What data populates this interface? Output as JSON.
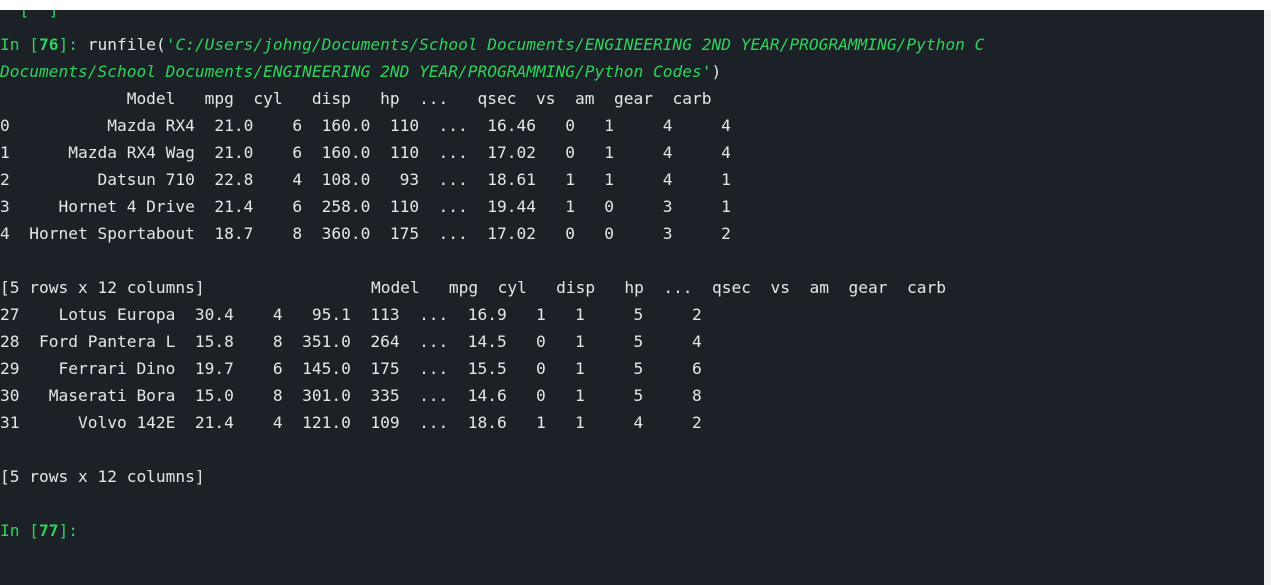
{
  "prev_prompt_fragment": "  [  ]",
  "input1": {
    "prompt_prefix": "In [",
    "prompt_number": "76",
    "prompt_suffix": "]: ",
    "call_name": "runfile(",
    "arg_line1": "'C:/Users/johng/Documents/School Documents/ENGINEERING 2ND YEAR/PROGRAMMING/Python C",
    "arg_line2": "Documents/School Documents/ENGINEERING 2ND YEAR/PROGRAMMING/Python Codes'",
    "close_paren": ")"
  },
  "head_table": {
    "header": "             Model   mpg  cyl   disp   hp  ...   qsec  vs  am  gear  carb",
    "rows": [
      "0          Mazda RX4  21.0    6  160.0  110  ...  16.46   0   1     4     4",
      "1      Mazda RX4 Wag  21.0    6  160.0  110  ...  17.02   0   1     4     4",
      "2         Datsun 710  22.8    4  108.0   93  ...  18.61   1   1     4     1",
      "3     Hornet 4 Drive  21.4    6  258.0  110  ...  19.44   1   0     3     1",
      "4  Hornet Sportabout  18.7    8  360.0  175  ...  17.02   0   0     3     2"
    ],
    "summary": "[5 rows x 12 columns]"
  },
  "tail_table": {
    "header": "            Model   mpg  cyl   disp   hp  ...  qsec  vs  am  gear  carb",
    "rows": [
      "27    Lotus Europa  30.4    4   95.1  113  ...  16.9   1   1     5     2",
      "28  Ford Pantera L  15.8    8  351.0  264  ...  14.5   0   1     5     4",
      "29    Ferrari Dino  19.7    6  145.0  175  ...  15.5   0   1     5     6",
      "30   Maserati Bora  15.0    8  301.0  335  ...  14.6   0   1     5     8",
      "31      Volvo 142E  21.4    4  121.0  109  ...  18.6   1   1     4     2"
    ],
    "summary": "[5 rows x 12 columns]"
  },
  "input2": {
    "prompt_prefix": "In [",
    "prompt_number": "77",
    "prompt_suffix": "]: "
  },
  "colors": {
    "background": "#1c2128",
    "text": "#e4e7ea",
    "prompt_green": "#2fd25a"
  }
}
